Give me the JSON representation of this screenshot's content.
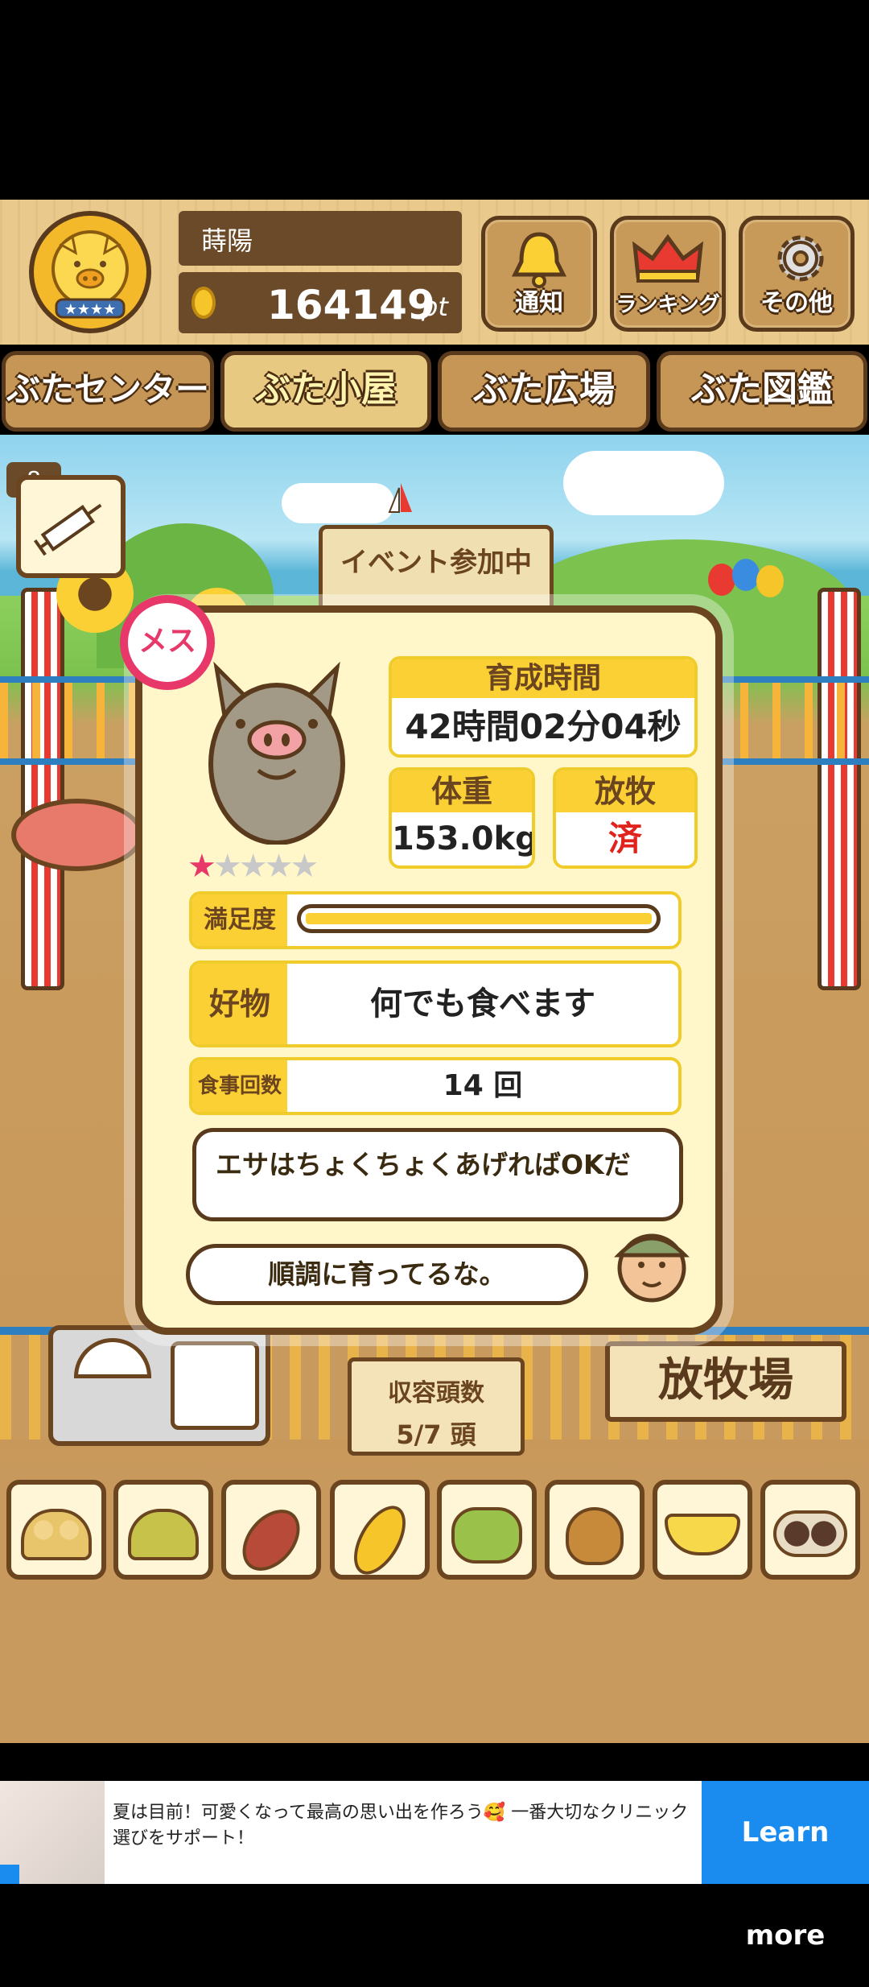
{
  "player": {
    "name": "蒔陽",
    "points": "164149",
    "points_unit": "pt"
  },
  "header_buttons": {
    "notify": "通知",
    "ranking": "ランキング",
    "other": "その他"
  },
  "tabs": [
    {
      "label": "ぶたセンター",
      "active": false
    },
    {
      "label": "ぶた小屋",
      "active": true
    },
    {
      "label": "ぶた広場",
      "active": false
    },
    {
      "label": "ぶた図鑑",
      "active": false
    }
  ],
  "syringe_count": "8",
  "event_sign": "イベント参加中",
  "pig": {
    "gender": "メス",
    "stars": 1,
    "stars_max": 5,
    "growth_time_label": "育成時間",
    "growth_time_value": "42時間02分04秒",
    "weight_label": "体重",
    "weight_value": "153.0kg",
    "grazing_label": "放牧",
    "grazing_value": "済",
    "satisfaction_label": "満足度",
    "satisfaction_level": 1.0,
    "favorite_label": "好物",
    "favorite_value": "何でも食べます",
    "meals_label": "食事回数",
    "meals_value": "14 回"
  },
  "farmer": {
    "comment1": "エサはちょくちょくあげればOKだ",
    "comment2": "順調に育ってるな。"
  },
  "capacity": {
    "label": "収容頭数",
    "value": "5/7 頭"
  },
  "pasture_sign": "放牧場",
  "foods": [
    "soybeans-icon",
    "mixed-grain-icon",
    "sweet-potato-icon",
    "corn-icon",
    "green-beans-icon",
    "acorn-icon",
    "bowl-grain-icon",
    "chocolate-ball-icon"
  ],
  "ad": {
    "text": "夏は目前！可愛くなって最高の思い出を作ろう🥰 一番大切なクリニック選びをサポート！",
    "cta": "Learn more"
  },
  "colors": {
    "accent_yellow": "#fbd035",
    "wood_dark": "#5a3a1c",
    "grazed_red": "#e0231c",
    "ad_blue": "#1a8cf0"
  }
}
